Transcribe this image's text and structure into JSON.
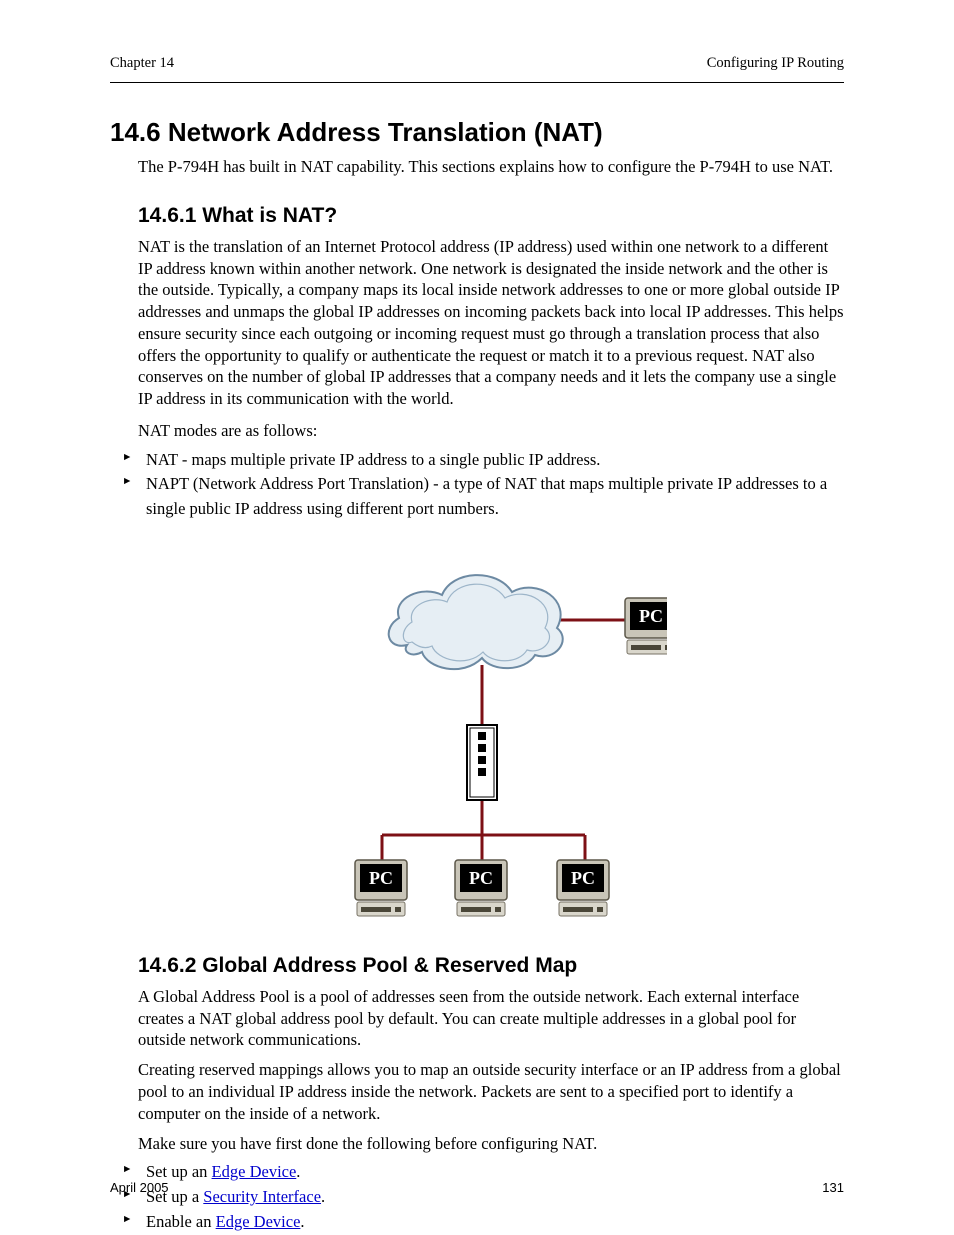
{
  "header": {
    "left": "Chapter 14",
    "right": "Configuring IP Routing"
  },
  "section": {
    "title": "14.6 Network Address Translation (NAT)",
    "intro": "The P-794H has built in NAT capability. This sections explains how to configure the P-794H to use NAT.",
    "sub1": {
      "title": "14.6.1 What is NAT?",
      "para1": "NAT is the translation of an Internet Protocol address (IP address) used within one network to a different IP address known within another network. One network is designated the inside network and the other is the outside. Typically, a company maps its local inside network addresses to one or more global outside IP addresses and unmaps the global IP addresses on incoming packets back into local IP addresses. This helps ensure security since each outgoing or incoming request must go through a translation process that also offers the opportunity to qualify or authenticate the request or match it to a previous request. NAT also conserves on the number of global IP addresses that a company needs and it lets the company use a single IP address in its communication with the world.",
      "para2": "NAT modes are as follows:",
      "bullets": [
        "NAT - maps multiple private IP address to a single public IP address.",
        "NAPT (Network Address Port Translation) - a type of NAT that maps multiple private IP addresses to a single public IP address using different port numbers."
      ]
    },
    "sub2": {
      "title": "14.6.2 Global Address Pool & Reserved Map",
      "para1": "A Global Address Pool is a pool of addresses seen from the outside network. Each external interface creates a NAT global address pool by default. You can create multiple addresses in a global pool for outside network communications.",
      "para2": "Creating reserved mappings allows you to map an outside security interface or an IP address from a global pool to an individual IP address inside the network. Packets are sent to a specified port to identify a computer on the inside of a network.",
      "para3": "Make sure you have first done the following before configuring NAT.",
      "links": [
        {
          "label": "Edge Device",
          "href": "#"
        },
        {
          "label": "Security Interface",
          "href": "#"
        },
        {
          "label": "Edge Device",
          "href": "#"
        }
      ],
      "linksTextPre": [
        "Set up an ",
        "Set up a ",
        "Enable an "
      ],
      "linksTextPost": [
        ".",
        ".",
        "."
      ]
    }
  },
  "footer": {
    "left": "April 2005",
    "right": "131"
  }
}
